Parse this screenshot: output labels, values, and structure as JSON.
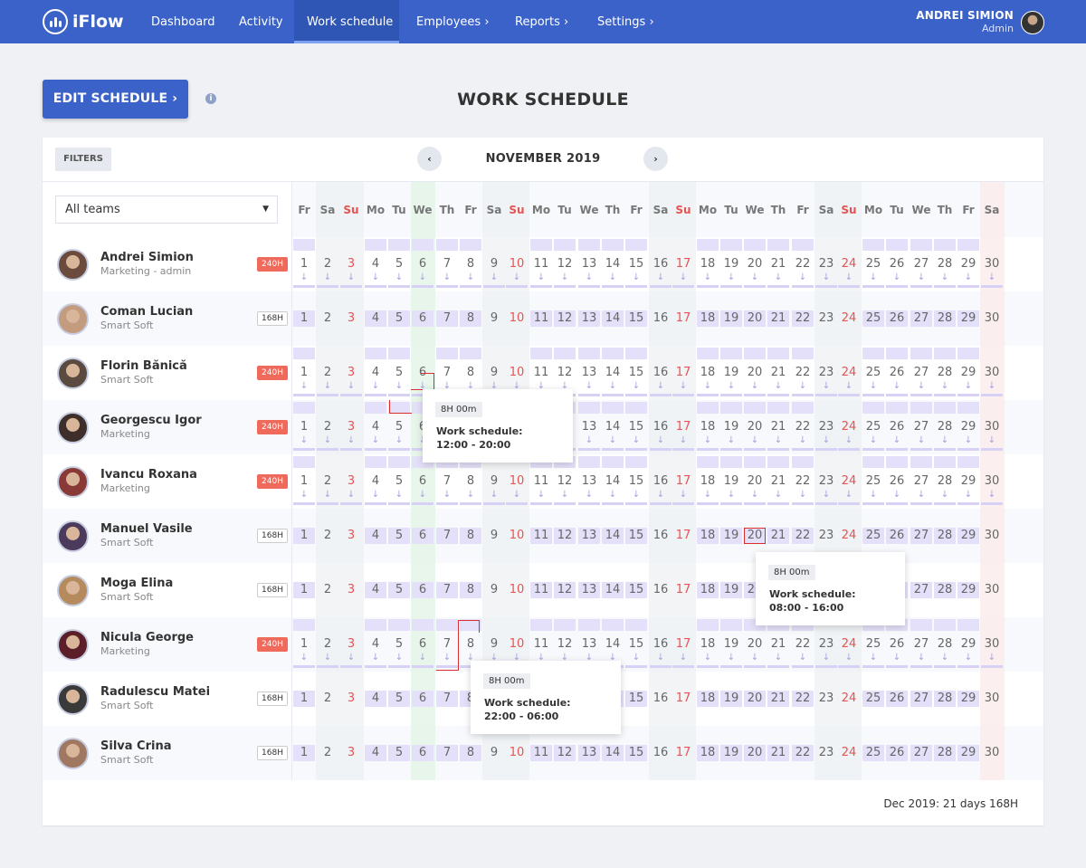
{
  "nav": {
    "logo": "iFlow",
    "items": [
      {
        "label": "Dashboard",
        "arrow": ""
      },
      {
        "label": "Activity",
        "arrow": ""
      },
      {
        "label": "Work schedule",
        "arrow": ""
      },
      {
        "label": "Employees",
        "arrow": "›"
      },
      {
        "label": "Reports",
        "arrow": "›"
      },
      {
        "label": "Settings",
        "arrow": "›"
      }
    ],
    "user_name": "ANDREI SIMION",
    "user_role": "Admin"
  },
  "header": {
    "edit_button": "EDIT SCHEDULE ›",
    "info": "i",
    "title": "WORK SCHEDULE"
  },
  "toolbar": {
    "filters": "FILTERS",
    "month": "NOVEMBER 2019",
    "prev": "‹",
    "next": "›",
    "team_select": "All teams",
    "caret": "▼"
  },
  "days": [
    {
      "num": "1",
      "dow": "Fr"
    },
    {
      "num": "2",
      "dow": "Sa"
    },
    {
      "num": "3",
      "dow": "Su"
    },
    {
      "num": "4",
      "dow": "Mo"
    },
    {
      "num": "5",
      "dow": "Tu"
    },
    {
      "num": "6",
      "dow": "We"
    },
    {
      "num": "7",
      "dow": "Th"
    },
    {
      "num": "8",
      "dow": "Fr"
    },
    {
      "num": "9",
      "dow": "Sa"
    },
    {
      "num": "10",
      "dow": "Su"
    },
    {
      "num": "11",
      "dow": "Mo"
    },
    {
      "num": "12",
      "dow": "Tu"
    },
    {
      "num": "13",
      "dow": "We"
    },
    {
      "num": "14",
      "dow": "Th"
    },
    {
      "num": "15",
      "dow": "Fr"
    },
    {
      "num": "16",
      "dow": "Sa"
    },
    {
      "num": "17",
      "dow": "Su"
    },
    {
      "num": "18",
      "dow": "Mo"
    },
    {
      "num": "19",
      "dow": "Tu"
    },
    {
      "num": "20",
      "dow": "We"
    },
    {
      "num": "21",
      "dow": "Th"
    },
    {
      "num": "22",
      "dow": "Fr"
    },
    {
      "num": "23",
      "dow": "Sa"
    },
    {
      "num": "24",
      "dow": "Su"
    },
    {
      "num": "25",
      "dow": "Mo"
    },
    {
      "num": "26",
      "dow": "Tu"
    },
    {
      "num": "27",
      "dow": "We"
    },
    {
      "num": "28",
      "dow": "Th"
    },
    {
      "num": "29",
      "dow": "Fr"
    },
    {
      "num": "30",
      "dow": "Sa"
    }
  ],
  "arrow_glyph": "↓",
  "employees": [
    {
      "name": "Andrei Simion",
      "team": "Marketing - admin",
      "hours": "240H",
      "type": "240"
    },
    {
      "name": "Coman Lucian",
      "team": "Smart Soft",
      "hours": "168H",
      "type": "168"
    },
    {
      "name": "Florin Bănică",
      "team": "Smart Soft",
      "hours": "240H",
      "type": "240"
    },
    {
      "name": "Georgescu Igor",
      "team": "Marketing",
      "hours": "240H",
      "type": "240"
    },
    {
      "name": "Ivancu Roxana",
      "team": "Marketing",
      "hours": "240H",
      "type": "240"
    },
    {
      "name": "Manuel Vasile",
      "team": "Smart Soft",
      "hours": "168H",
      "type": "168"
    },
    {
      "name": "Moga Elina",
      "team": "Smart Soft",
      "hours": "168H",
      "type": "168"
    },
    {
      "name": "Nicula George",
      "team": "Marketing",
      "hours": "240H",
      "type": "240"
    },
    {
      "name": "Radulescu Matei",
      "team": "Smart Soft",
      "hours": "168H",
      "type": "168"
    },
    {
      "name": "Silva Crina",
      "team": "Smart Soft",
      "hours": "168H",
      "type": "168"
    }
  ],
  "tooltips": [
    {
      "duration": "8H 00m",
      "label": "Work schedule:",
      "time": "12:00 - 20:00"
    },
    {
      "duration": "8H 00m",
      "label": "Work schedule:",
      "time": "08:00 - 16:00"
    },
    {
      "duration": "8H 00m",
      "label": "Work schedule:",
      "time": "22:00 - 06:00"
    }
  ],
  "footer": "Dec 2019: 21 days 168H",
  "colors": {
    "nav": "#3b62c8",
    "accent": "#3b62c8",
    "badge_red": "#ef6a5b",
    "sunday": "#e55353",
    "shift_fill": "#e4e0fa"
  }
}
